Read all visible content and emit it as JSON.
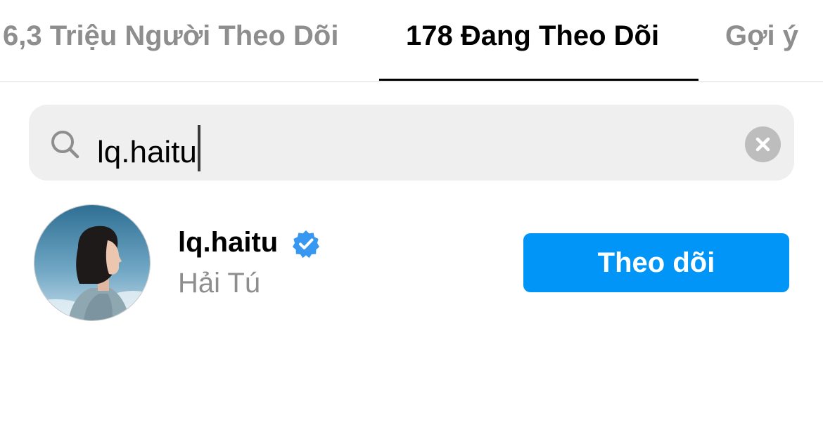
{
  "tabs": {
    "followers_label": "6,3 Triệu Người Theo Dõi",
    "following_label": "178 Đang Theo Dõi",
    "suggested_label": "Gợi ý",
    "active": "following"
  },
  "search": {
    "value": "lq.haitu",
    "icon": "search-icon",
    "clear_icon": "clear-icon"
  },
  "results": [
    {
      "username": "lq.haitu",
      "verified": true,
      "full_name": "Hải Tú",
      "follow_label": "Theo dõi"
    }
  ],
  "colors": {
    "accent": "#0095f6",
    "verified": "#3897f0",
    "muted_text": "#8e8e8e",
    "search_bg": "#efefef"
  }
}
